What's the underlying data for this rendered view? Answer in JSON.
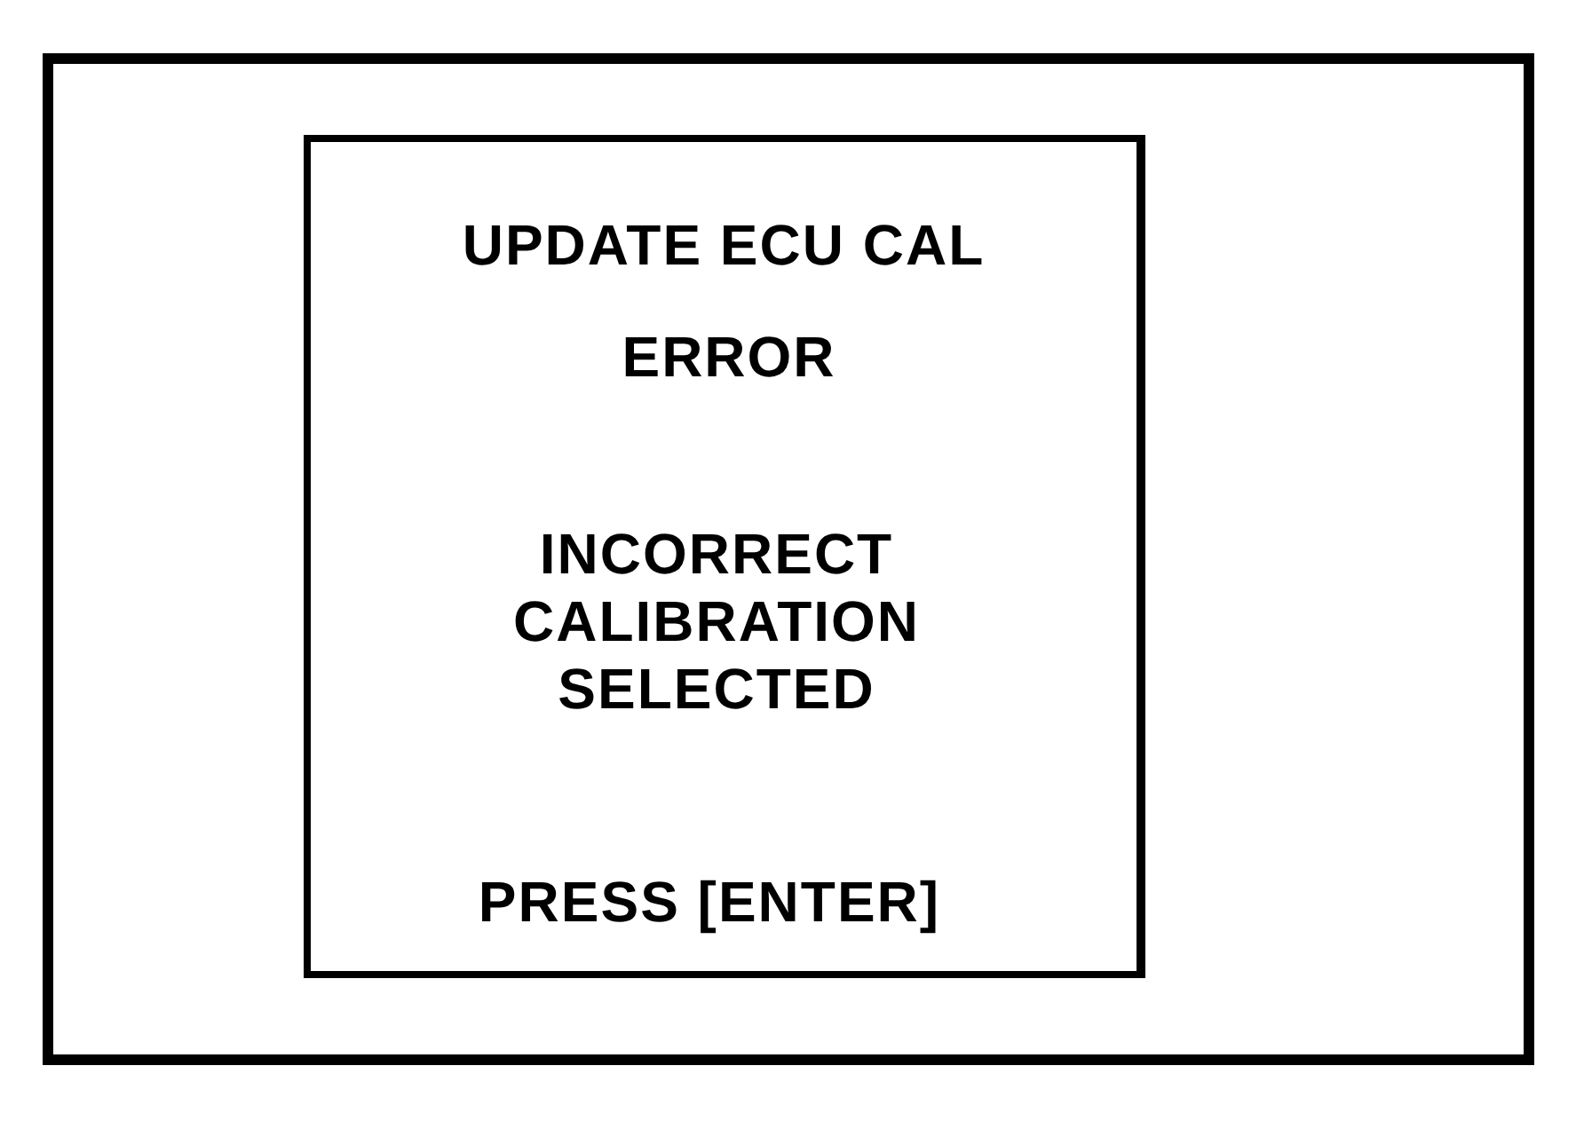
{
  "screen": {
    "title": "UPDATE ECU CAL",
    "status": "ERROR",
    "message_lines": [
      "INCORRECT",
      "CALIBRATION",
      "SELECTED"
    ],
    "prompt": "PRESS [ENTER]"
  }
}
